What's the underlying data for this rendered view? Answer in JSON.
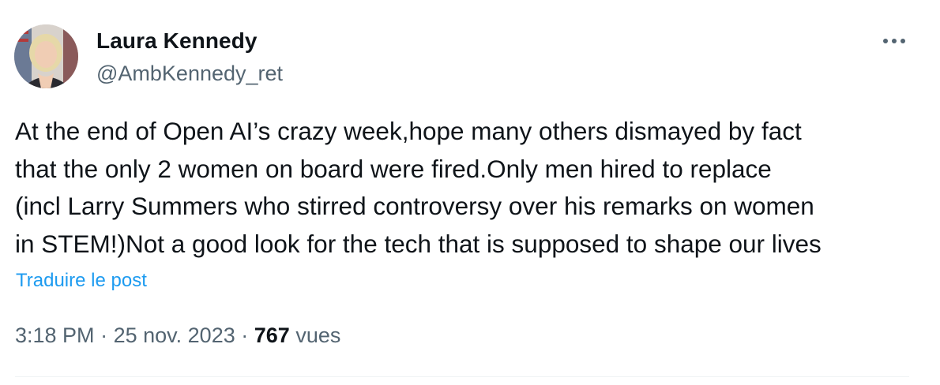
{
  "author": {
    "name": "Laura Kennedy",
    "handle": "@AmbKennedy_ret"
  },
  "tweet": {
    "lines": [
      "At the end of Open AI’s crazy week,hope many others dismayed by fact",
      "that the only 2 women on board were fired.Only men hired to replace",
      "(incl Larry Summers who stirred controversy over his remarks on women",
      "in STEM!)Not a good look for the tech that is supposed to shape our lives"
    ],
    "translate_label": "Traduire le post"
  },
  "meta": {
    "time": "3:18 PM",
    "separator": "·",
    "date": "25 nov. 2023",
    "views_count": "767",
    "views_label": "vues"
  },
  "icons": {
    "more": "more-horizontal-icon",
    "avatar": "avatar"
  },
  "colors": {
    "text_primary": "#0f1419",
    "text_secondary": "#536471",
    "link": "#1d9bf0",
    "divider": "#eff3f4"
  }
}
